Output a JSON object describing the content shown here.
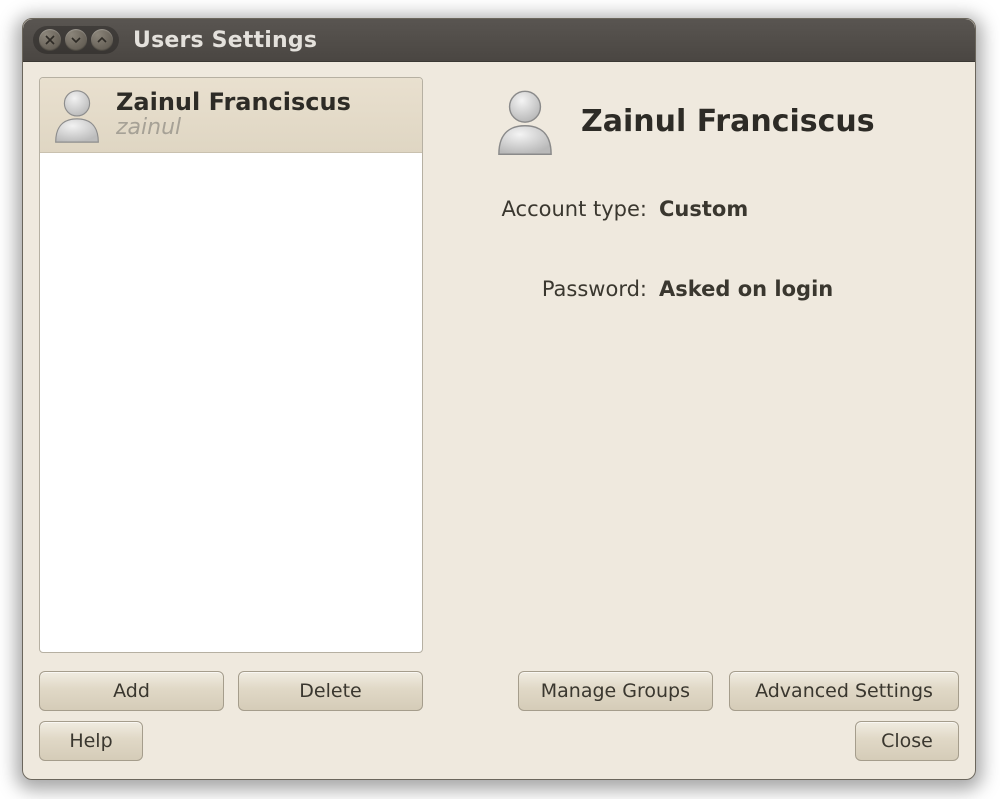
{
  "window": {
    "title": "Users Settings"
  },
  "users": [
    {
      "full_name": "Zainul Franciscus",
      "username": "zainul"
    }
  ],
  "detail": {
    "full_name": "Zainul Franciscus",
    "account_type_label": "Account type:",
    "account_type_value": "Custom",
    "password_label": "Password:",
    "password_value": "Asked on login"
  },
  "buttons": {
    "add": "Add",
    "delete": "Delete",
    "manage_groups": "Manage Groups",
    "advanced_settings": "Advanced Settings",
    "help": "Help",
    "close": "Close"
  }
}
